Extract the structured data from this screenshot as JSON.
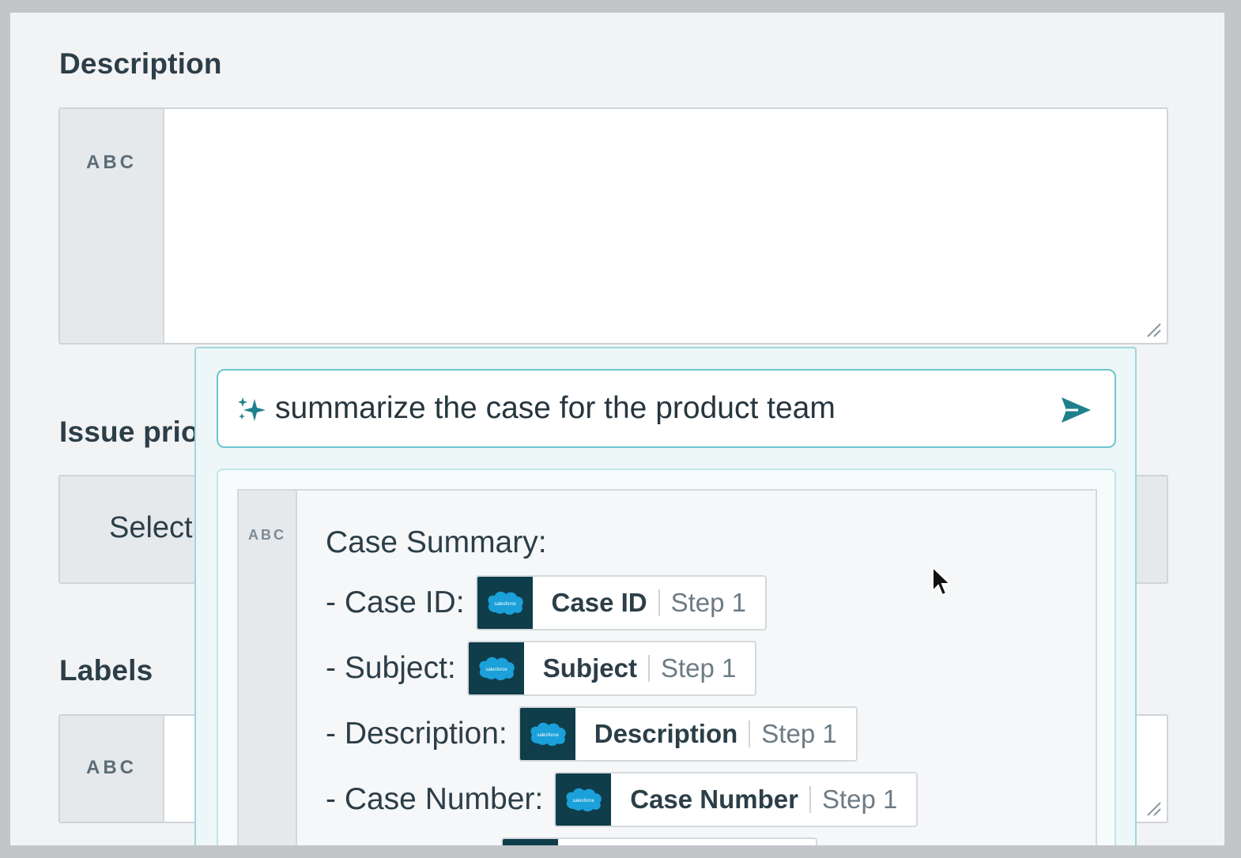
{
  "description": {
    "label": "Description",
    "type_badge": "ABC"
  },
  "issue_priority": {
    "label_visible": "Issue prio",
    "select_value_visible": "Select"
  },
  "labels": {
    "label": "Labels",
    "type_badge": "ABC"
  },
  "ai_panel": {
    "prompt": "summarize the case for the product team",
    "sparkle_icon": "sparkle-icon",
    "send_icon": "send-icon",
    "result": {
      "type_badge": "ABC",
      "title": "Case Summary:",
      "rows": [
        {
          "label": "- Case ID:",
          "pill_name": "Case ID",
          "pill_step": "Step 1",
          "app": "salesforce"
        },
        {
          "label": "- Subject:",
          "pill_name": "Subject",
          "pill_step": "Step 1",
          "app": "salesforce"
        },
        {
          "label": "- Description:",
          "pill_name": "Description",
          "pill_step": "Step 1",
          "app": "salesforce"
        },
        {
          "label": "- Case Number:",
          "pill_name": "Case Number",
          "pill_step": "Step 1",
          "app": "salesforce"
        }
      ]
    }
  },
  "colors": {
    "accent": "#6cc6cd",
    "panel_bg": "#eef7f8",
    "salesforce_tile": "#0f3d4a",
    "salesforce_cloud": "#1ba0d9"
  }
}
